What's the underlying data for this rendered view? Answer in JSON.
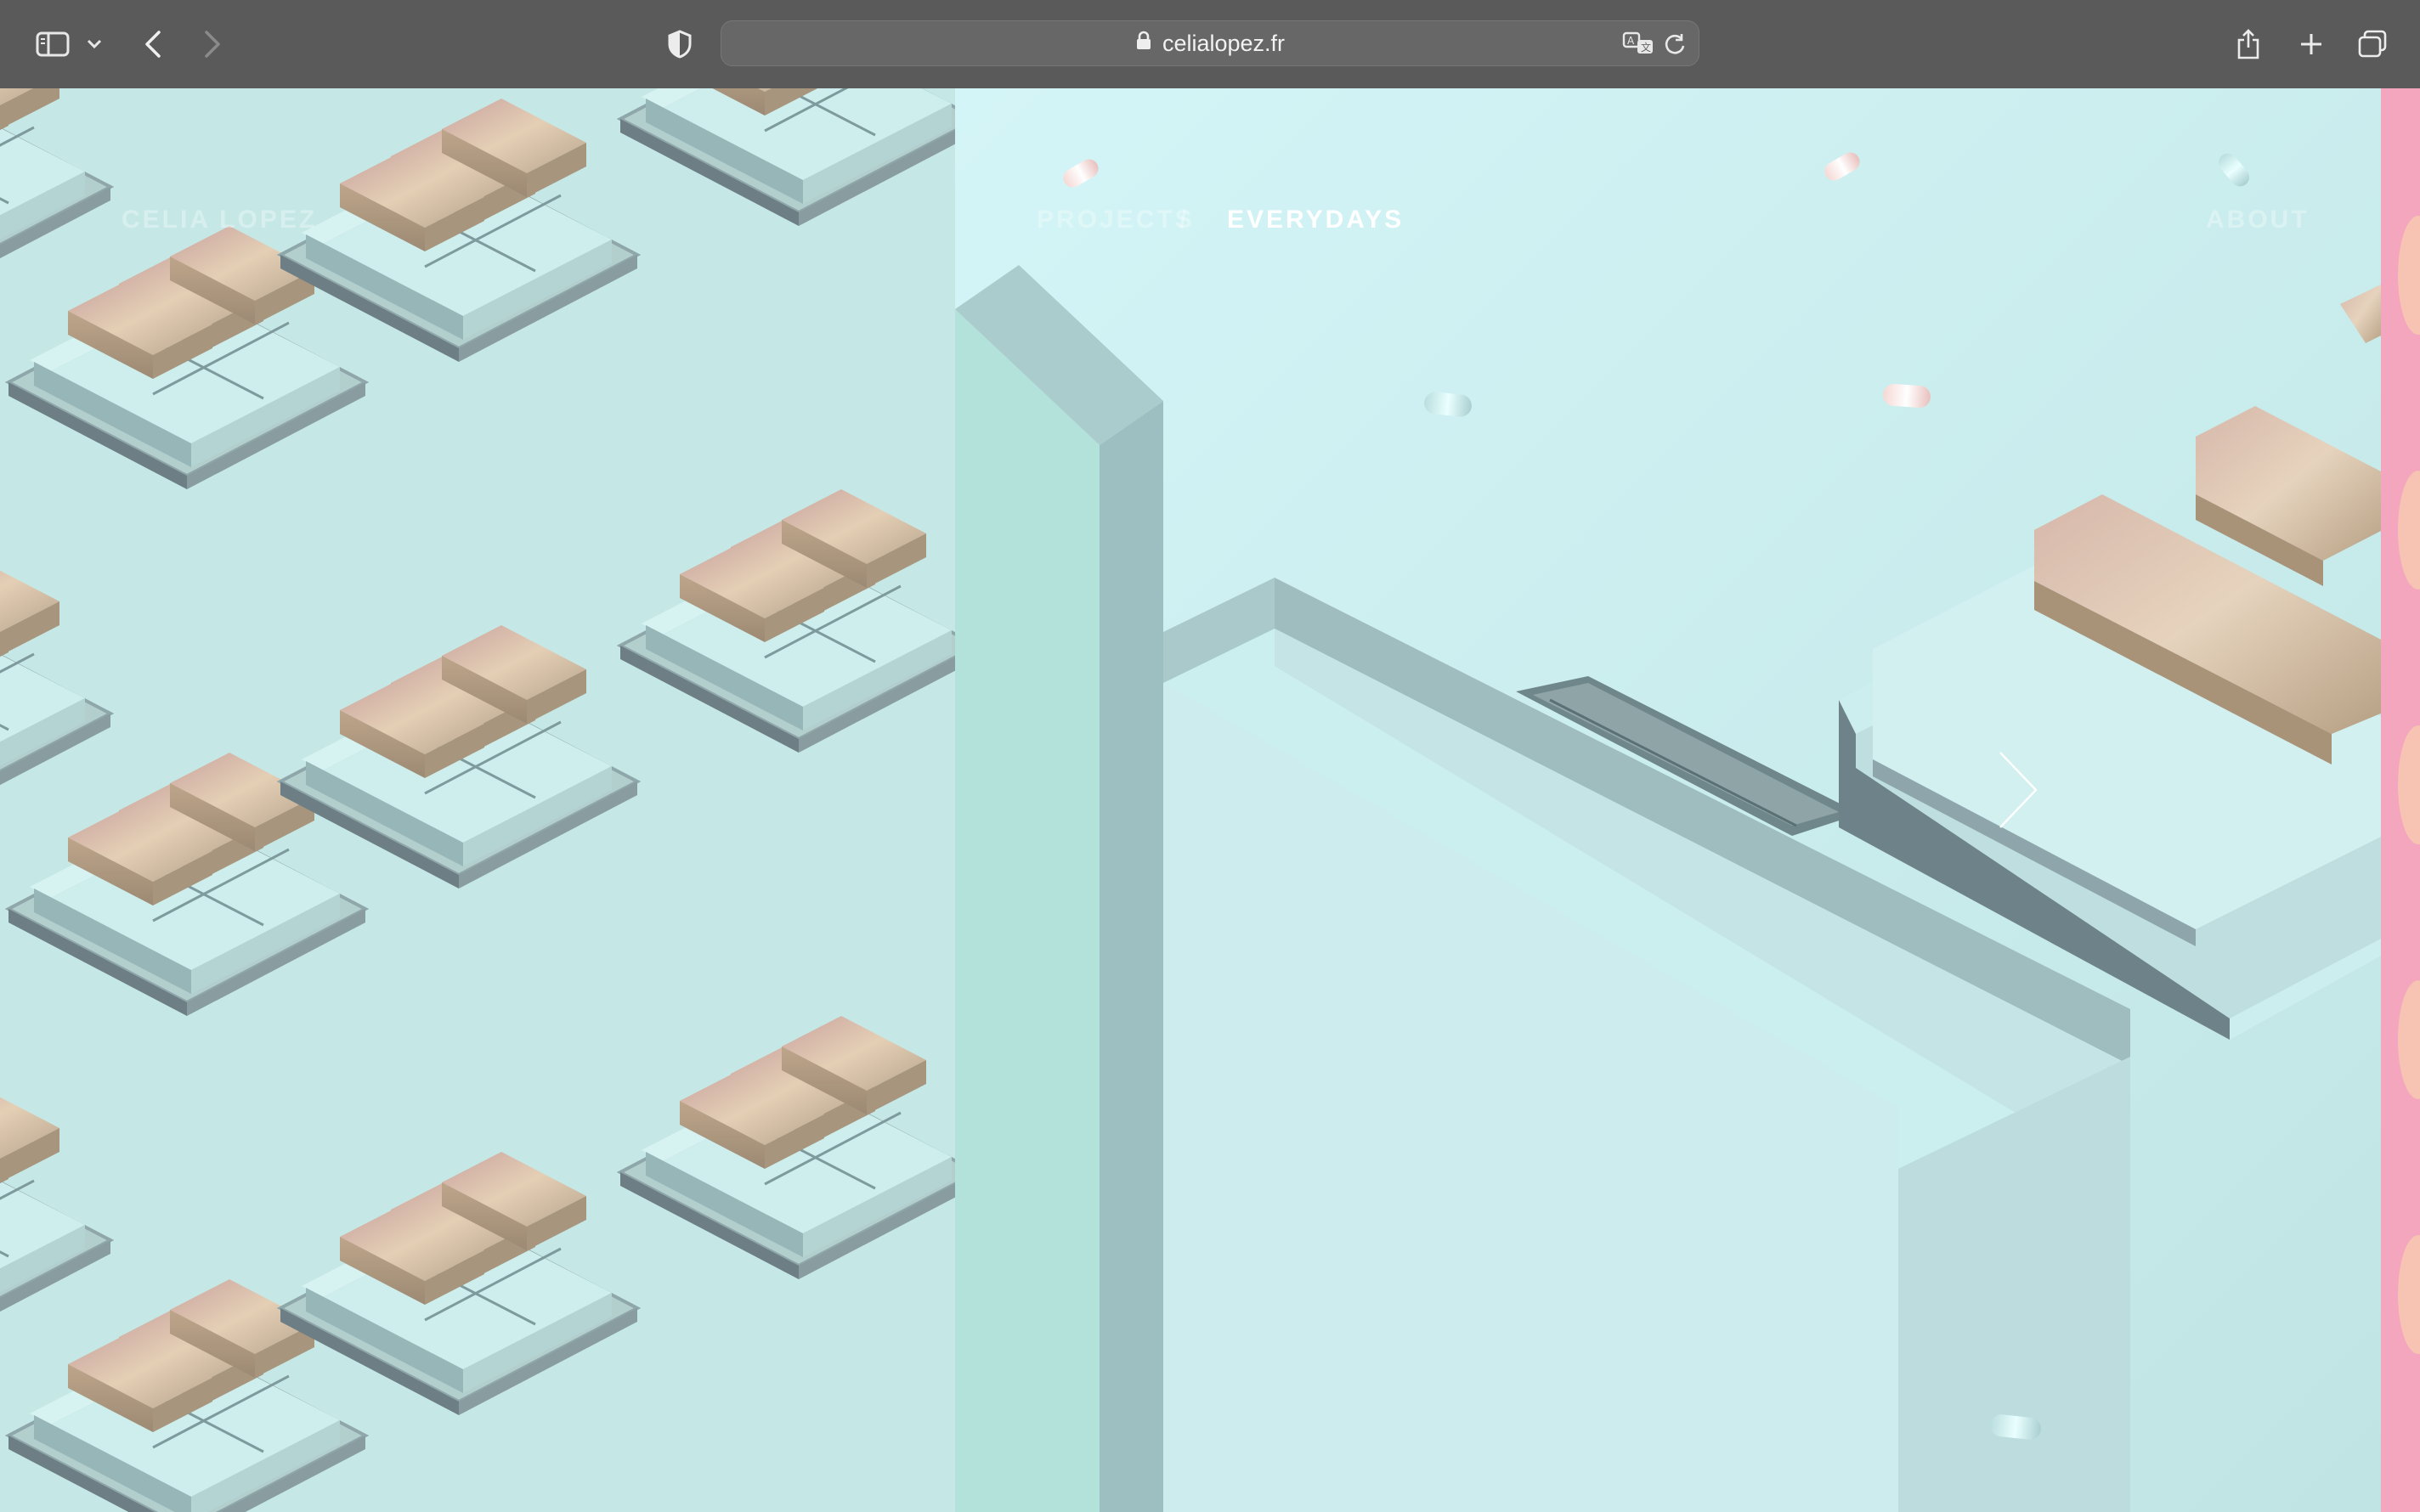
{
  "browser": {
    "url": "celialopez.fr",
    "icons": {
      "sidebar": "sidebar-icon",
      "sidebar_menu": "chevron-down-icon",
      "back": "chevron-left-icon",
      "forward": "chevron-right-icon",
      "privacy": "shield-icon",
      "lock": "lock-icon",
      "translate": "translate-icon",
      "reload": "reload-icon",
      "share": "share-icon",
      "new_tab": "plus-icon",
      "tabs": "tabs-overview-icon"
    }
  },
  "site": {
    "logo": "CELIA LOPEZ",
    "nav": {
      "projects": "PROJECTS",
      "separator": "/",
      "everydays": "EVERYDAYS",
      "about": "ABOUT"
    },
    "slider": {
      "next_icon": "chevron-right-icon"
    }
  },
  "colors": {
    "chrome": "#5a5a5a",
    "url_bar": "#676767",
    "scene_mint": "#c5e8e6",
    "tile_gold": "#d8c0a6",
    "tile_pink": "#d9a9a6",
    "accent_pink": "#f2a5bd"
  }
}
